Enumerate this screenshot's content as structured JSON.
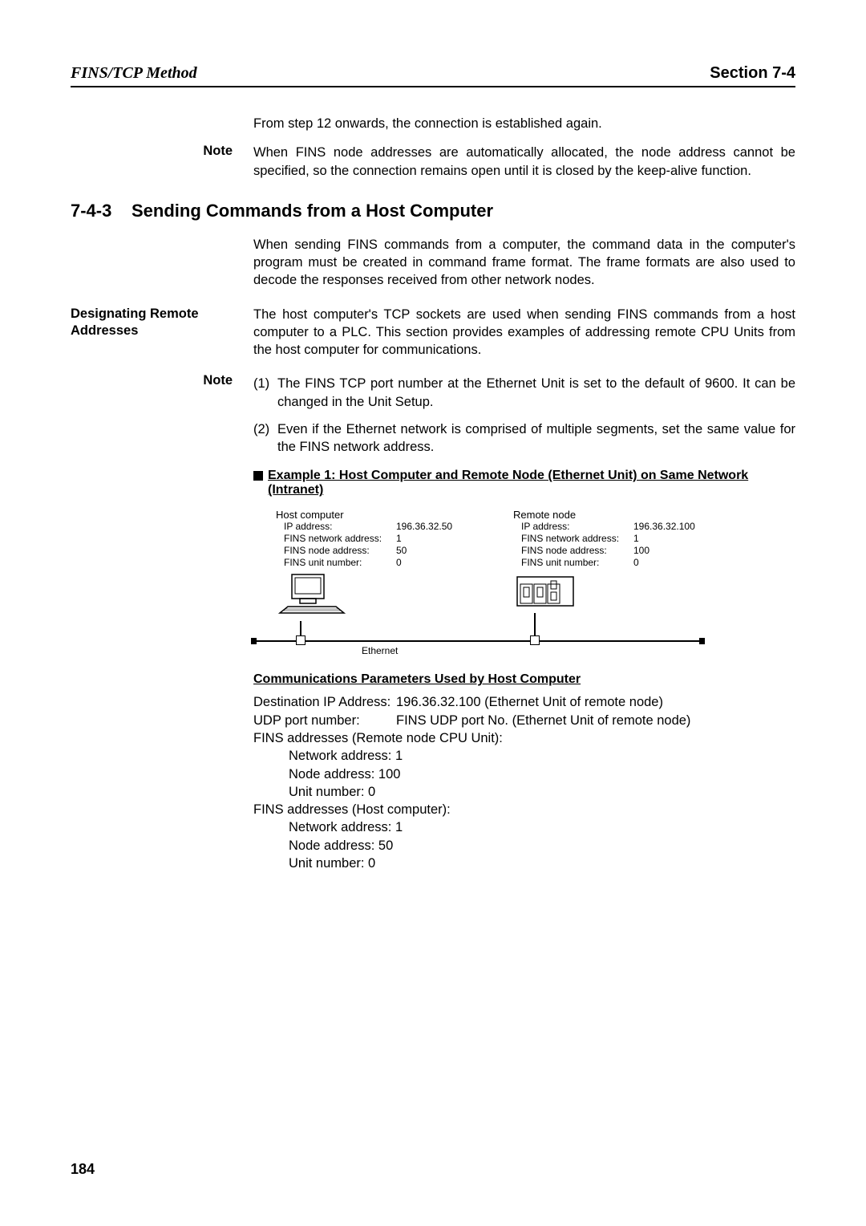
{
  "header": {
    "left": "FINS/TCP Method",
    "right": "Section 7-4"
  },
  "intro_para": "From step 12 onwards, the connection is established again.",
  "note1": {
    "label": "Note",
    "text": "When FINS node addresses are automatically allocated, the node address cannot be specified, so the connection remains open until it is closed by the keep-alive function."
  },
  "section": {
    "num": "7-4-3",
    "title": "Sending Commands from a Host Computer"
  },
  "section_para": "When sending FINS commands from a computer, the command data in the computer's program must be created in command frame format. The frame formats are also used to decode the responses received from other network nodes.",
  "side_heading": "Designating Remote Addresses",
  "side_para": "The host computer's TCP sockets are used when sending FINS commands from a host computer to a PLC. This section provides examples of addressing remote CPU Units from the host computer for communications.",
  "note2": {
    "label": "Note",
    "items": [
      {
        "num": "(1)",
        "text": "The FINS TCP port number at the Ethernet Unit is set to the default of 9600. It can be changed in the Unit Setup."
      },
      {
        "num": "(2)",
        "text": "Even if the Ethernet network is comprised of multiple segments, set the same value for the FINS network address."
      }
    ]
  },
  "example_title": "Example 1: Host Computer and Remote Node (Ethernet Unit) on Same Network (Intranet)",
  "diagram": {
    "host": {
      "title": "Host computer",
      "rows": [
        {
          "k": "IP address:",
          "v": "196.36.32.50"
        },
        {
          "k": "FINS network address:",
          "v": "1"
        },
        {
          "k": "FINS node address:",
          "v": "50"
        },
        {
          "k": "FINS unit number:",
          "v": "0"
        }
      ]
    },
    "remote": {
      "title": "Remote node",
      "rows": [
        {
          "k": "IP address:",
          "v": "196.36.32.100"
        },
        {
          "k": "FINS network address:",
          "v": "1"
        },
        {
          "k": "FINS node address:",
          "v": "100"
        },
        {
          "k": "FINS unit number:",
          "v": "0"
        }
      ]
    },
    "ethernet_label": "Ethernet"
  },
  "params_heading": "Communications Parameters Used by Host Computer",
  "params": {
    "dest_ip": {
      "label": "Destination IP Address:",
      "value": "196.36.32.100 (Ethernet Unit of remote node)"
    },
    "udp": {
      "label": "UDP port number:",
      "value": "FINS UDP port No. (Ethernet Unit of remote node)"
    },
    "remote_heading": "FINS addresses (Remote node CPU Unit):",
    "remote": {
      "net": "Network address: 1",
      "node": "Node address: 100",
      "unit": "Unit number: 0"
    },
    "host_heading": "FINS addresses (Host computer):",
    "host": {
      "net": "Network address: 1",
      "node": "Node address: 50",
      "unit": "Unit number: 0"
    }
  },
  "page_number": "184"
}
